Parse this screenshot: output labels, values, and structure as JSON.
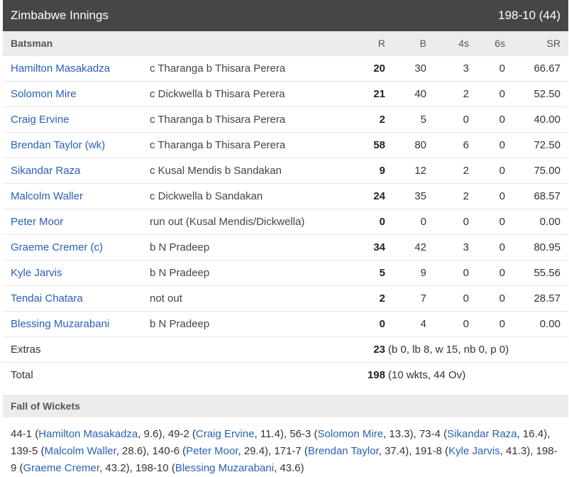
{
  "header": {
    "title": "Zimbabwe Innings",
    "score": "198-10 (44)"
  },
  "columns": {
    "batsman": "Batsman",
    "r": "R",
    "b": "B",
    "fours": "4s",
    "sixes": "6s",
    "sr": "SR"
  },
  "batsmen": [
    {
      "name": "Hamilton Masakadza",
      "dismissal": "c Tharanga b Thisara Perera",
      "r": "20",
      "b": "30",
      "fours": "3",
      "sixes": "0",
      "sr": "66.67"
    },
    {
      "name": "Solomon Mire",
      "dismissal": "c Dickwella b Thisara Perera",
      "r": "21",
      "b": "40",
      "fours": "2",
      "sixes": "0",
      "sr": "52.50"
    },
    {
      "name": "Craig Ervine",
      "dismissal": "c Tharanga b Thisara Perera",
      "r": "2",
      "b": "5",
      "fours": "0",
      "sixes": "0",
      "sr": "40.00"
    },
    {
      "name": "Brendan Taylor (wk)",
      "dismissal": "c Tharanga b Thisara Perera",
      "r": "58",
      "b": "80",
      "fours": "6",
      "sixes": "0",
      "sr": "72.50"
    },
    {
      "name": "Sikandar Raza",
      "dismissal": "c Kusal Mendis b Sandakan",
      "r": "9",
      "b": "12",
      "fours": "2",
      "sixes": "0",
      "sr": "75.00"
    },
    {
      "name": "Malcolm Waller",
      "dismissal": "c Dickwella b Sandakan",
      "r": "24",
      "b": "35",
      "fours": "2",
      "sixes": "0",
      "sr": "68.57"
    },
    {
      "name": "Peter Moor",
      "dismissal": "run out (Kusal Mendis/Dickwella)",
      "r": "0",
      "b": "0",
      "fours": "0",
      "sixes": "0",
      "sr": "0.00"
    },
    {
      "name": "Graeme Cremer (c)",
      "dismissal": "b N Pradeep",
      "r": "34",
      "b": "42",
      "fours": "3",
      "sixes": "0",
      "sr": "80.95"
    },
    {
      "name": "Kyle Jarvis",
      "dismissal": "b N Pradeep",
      "r": "5",
      "b": "9",
      "fours": "0",
      "sixes": "0",
      "sr": "55.56"
    },
    {
      "name": "Tendai Chatara",
      "dismissal": "not out",
      "r": "2",
      "b": "7",
      "fours": "0",
      "sixes": "0",
      "sr": "28.57"
    },
    {
      "name": "Blessing Muzarabani",
      "dismissal": "b N Pradeep",
      "r": "0",
      "b": "4",
      "fours": "0",
      "sixes": "0",
      "sr": "0.00"
    }
  ],
  "extras": {
    "label": "Extras",
    "value": "23",
    "detail": "(b 0, lb 8, w 15, nb 0, p 0)"
  },
  "total": {
    "label": "Total",
    "value": "198",
    "detail": "(10 wkts, 44 Ov)"
  },
  "fall_of_wickets": {
    "title": "Fall of Wickets",
    "items": [
      {
        "score": "44-1",
        "name": "Hamilton Masakadza",
        "over": "9.6"
      },
      {
        "score": "49-2",
        "name": "Craig Ervine",
        "over": "11.4"
      },
      {
        "score": "56-3",
        "name": "Solomon Mire",
        "over": "13.3"
      },
      {
        "score": "73-4",
        "name": "Sikandar Raza",
        "over": "16.4"
      },
      {
        "score": "139-5",
        "name": "Malcolm Waller",
        "over": "28.6"
      },
      {
        "score": "140-6",
        "name": "Peter Moor",
        "over": "29.4"
      },
      {
        "score": "171-7",
        "name": "Brendan Taylor",
        "over": "37.4"
      },
      {
        "score": "191-8",
        "name": "Kyle Jarvis",
        "over": "41.3"
      },
      {
        "score": "198-9",
        "name": "Graeme Cremer",
        "over": "43.2"
      },
      {
        "score": "198-10",
        "name": "Blessing Muzarabani",
        "over": "43.6"
      }
    ]
  },
  "colors": {
    "header_bg": "#464646",
    "link": "#2a5fb7",
    "subheader_bg": "#ececec"
  }
}
